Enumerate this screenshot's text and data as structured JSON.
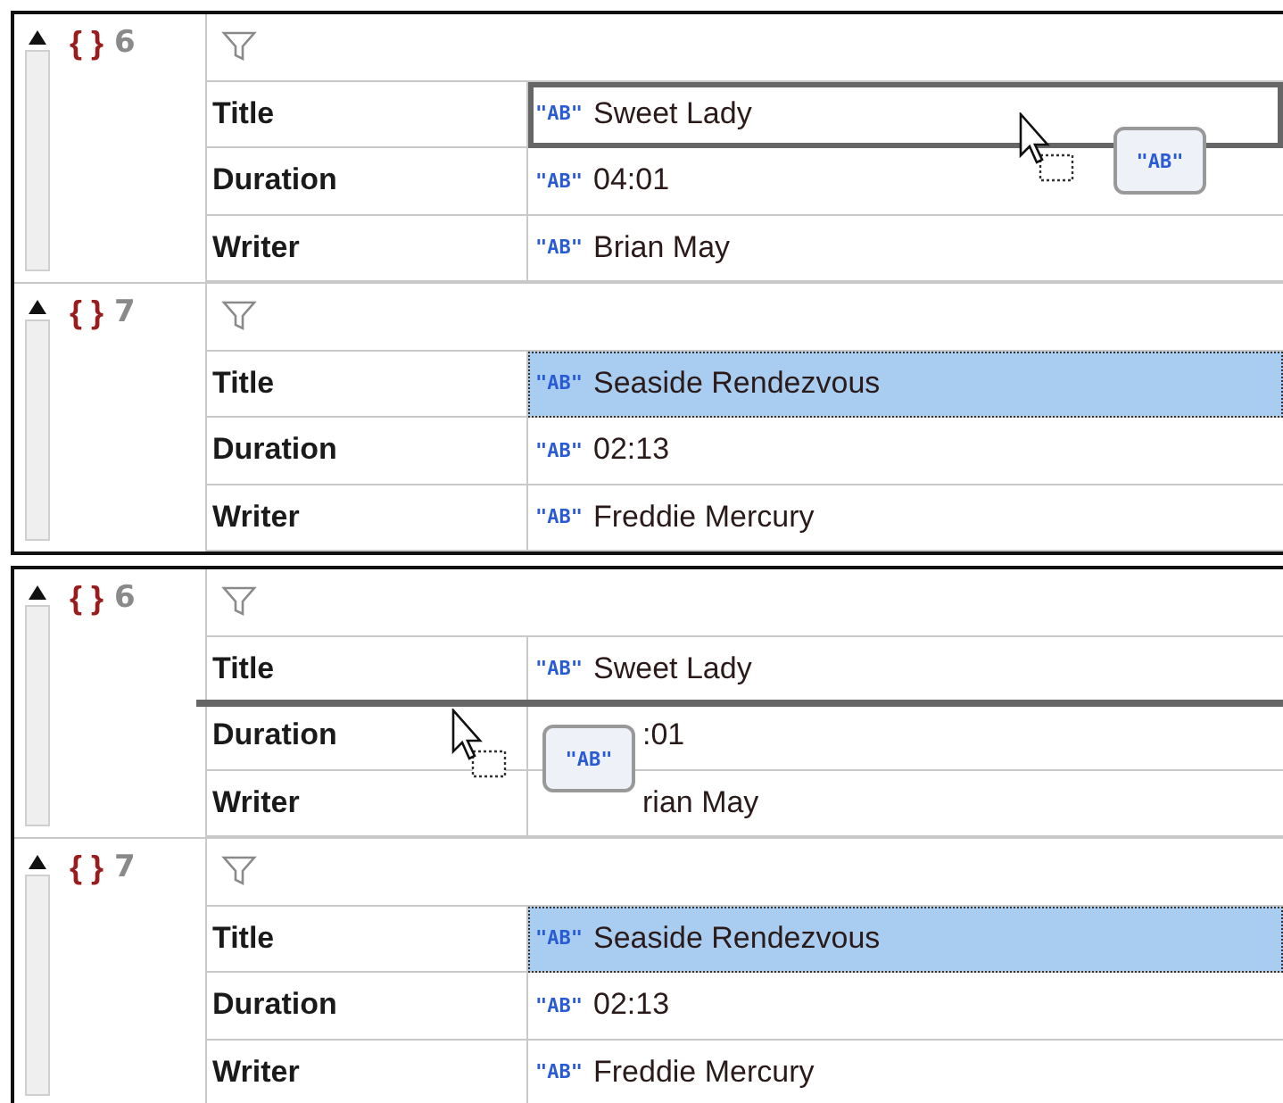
{
  "panels": [
    {
      "drag_badge": "\"AB\"",
      "records": [
        {
          "brace": "{ }",
          "index": "6",
          "fields": [
            {
              "key": "Title",
              "type_icon": "\"AB\"",
              "value": "Sweet Lady",
              "selected": false,
              "drop_outline": true
            },
            {
              "key": "Duration",
              "type_icon": "\"AB\"",
              "value": "04:01",
              "selected": false
            },
            {
              "key": "Writer",
              "type_icon": "\"AB\"",
              "value": "Brian May",
              "selected": false
            }
          ]
        },
        {
          "brace": "{ }",
          "index": "7",
          "fields": [
            {
              "key": "Title",
              "type_icon": "\"AB\"",
              "value": "Seaside Rendezvous",
              "selected": true
            },
            {
              "key": "Duration",
              "type_icon": "\"AB\"",
              "value": "02:13",
              "selected": false
            },
            {
              "key": "Writer",
              "type_icon": "\"AB\"",
              "value": "Freddie Mercury",
              "selected": false
            }
          ]
        }
      ]
    },
    {
      "drag_badge": "\"AB\"",
      "records": [
        {
          "brace": "{ }",
          "index": "6",
          "fields": [
            {
              "key": "Title",
              "type_icon": "\"AB\"",
              "value": "Sweet Lady",
              "selected": false,
              "drop_line_below": true
            },
            {
              "key": "Duration",
              "value": ":01",
              "selected": false,
              "covered": true
            },
            {
              "key": "Writer",
              "value": "rian May",
              "selected": false,
              "covered": true
            }
          ]
        },
        {
          "brace": "{ }",
          "index": "7",
          "fields": [
            {
              "key": "Title",
              "type_icon": "\"AB\"",
              "value": "Seaside Rendezvous",
              "selected": true
            },
            {
              "key": "Duration",
              "type_icon": "\"AB\"",
              "value": "02:13",
              "selected": false
            },
            {
              "key": "Writer",
              "type_icon": "\"AB\"",
              "value": "Freddie Mercury",
              "selected": false
            }
          ]
        }
      ]
    }
  ]
}
